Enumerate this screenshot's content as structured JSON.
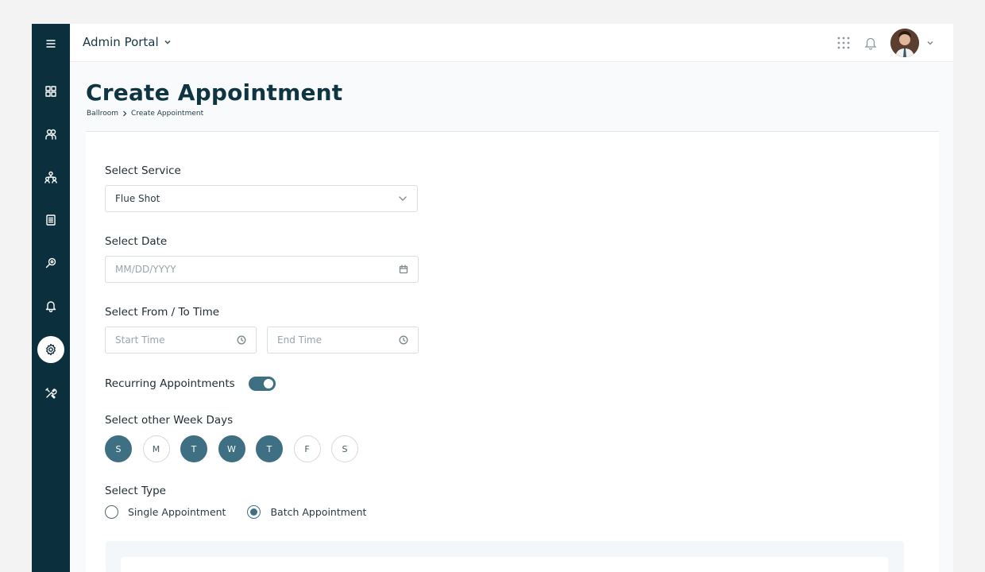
{
  "app": {
    "title": "Admin Portal"
  },
  "sidebar": {
    "items": [
      {
        "name": "menu",
        "icon": "hamburger-icon"
      },
      {
        "name": "dashboard",
        "icon": "grid-icon"
      },
      {
        "name": "clients",
        "icon": "users-icon"
      },
      {
        "name": "teams",
        "icon": "org-chart-icon"
      },
      {
        "name": "documents",
        "icon": "document-icon"
      },
      {
        "name": "search",
        "icon": "search-icon"
      },
      {
        "name": "notifications",
        "icon": "bell-icon"
      },
      {
        "name": "settings",
        "icon": "gear-icon",
        "active": true
      },
      {
        "name": "tools",
        "icon": "tools-icon"
      }
    ]
  },
  "page": {
    "title": "Create Appointment",
    "breadcrumb": [
      "Ballroom",
      "Create Appointment"
    ]
  },
  "form": {
    "service": {
      "label": "Select Service",
      "value": "Flue Shot"
    },
    "date": {
      "label": "Select Date",
      "placeholder": "MM/DD/YYYY"
    },
    "time": {
      "label": "Select From / To Time",
      "start_placeholder": "Start Time",
      "end_placeholder": "End Time"
    },
    "recurring": {
      "label": "Recurring Appointments",
      "enabled": true
    },
    "weekdays": {
      "label": "Select other Week Days",
      "days": [
        {
          "label": "S",
          "selected": true
        },
        {
          "label": "M",
          "selected": false
        },
        {
          "label": "T",
          "selected": true
        },
        {
          "label": "W",
          "selected": true
        },
        {
          "label": "T",
          "selected": true
        },
        {
          "label": "F",
          "selected": false
        },
        {
          "label": "S",
          "selected": false
        }
      ]
    },
    "type": {
      "label": "Select Type",
      "options": [
        {
          "label": "Single Appointment",
          "selected": false
        },
        {
          "label": "Batch Appointment",
          "selected": true
        }
      ]
    }
  },
  "colors": {
    "sidebar": "#0b2f3d",
    "accent": "#3e6f83",
    "title": "#0f3442"
  }
}
